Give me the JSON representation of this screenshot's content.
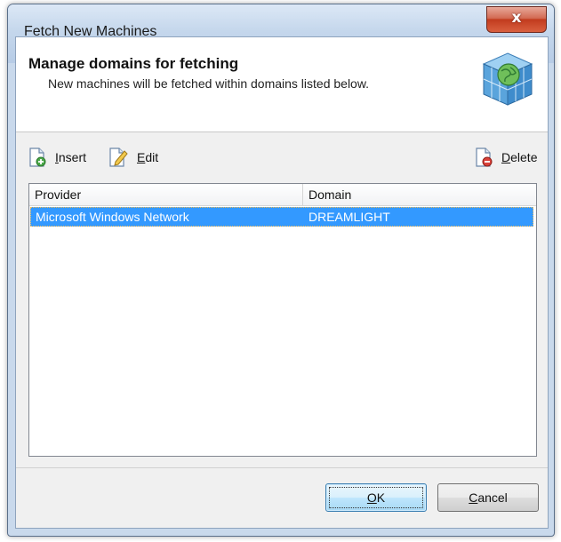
{
  "window": {
    "title": "Fetch New Machines",
    "close_symbol": "x"
  },
  "header": {
    "title": "Manage domains for fetching",
    "subtitle": "New machines will be fetched within domains listed below.",
    "graphic_icon": "network-globe-cube-icon"
  },
  "toolbar": {
    "insert": {
      "label_first": "I",
      "label_rest": "nsert",
      "icon": "insert-icon"
    },
    "edit": {
      "label_first": "E",
      "label_rest": "dit",
      "icon": "edit-icon"
    },
    "delete": {
      "label_first": "D",
      "label_rest": "elete",
      "icon": "delete-icon"
    }
  },
  "list": {
    "columns": [
      "Provider",
      "Domain"
    ],
    "rows": [
      {
        "provider": "Microsoft Windows Network",
        "domain": "DREAMLIGHT",
        "selected": true
      }
    ]
  },
  "buttons": {
    "ok": {
      "first": "O",
      "rest": "K"
    },
    "cancel": {
      "first": "C",
      "rest": "ancel"
    }
  },
  "colors": {
    "selection": "#3399ff",
    "close_button": "#c23b1e",
    "titlebar": "#c5d7ec"
  }
}
